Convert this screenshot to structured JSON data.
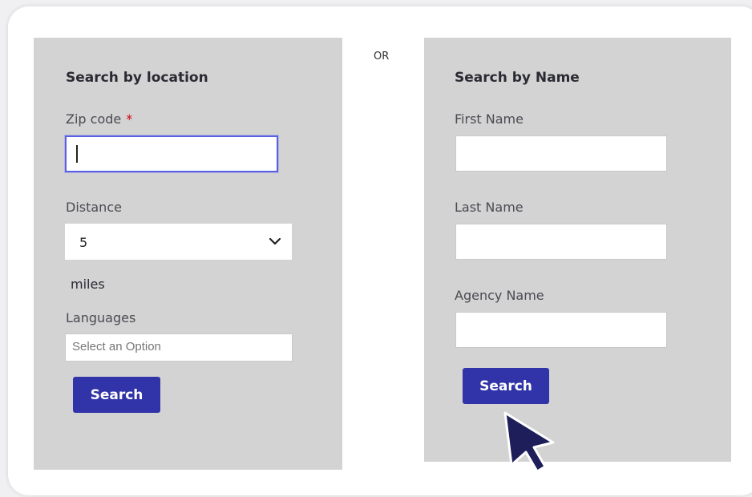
{
  "location_search": {
    "heading": "Search by location",
    "zip_label": "Zip code",
    "required_mark": "*",
    "zip_value": "",
    "distance_label": "Distance",
    "distance_value": "5",
    "distance_unit": "miles",
    "languages_label": "Languages",
    "languages_placeholder": "Select an Option",
    "search_label": "Search"
  },
  "separator": "OR",
  "name_search": {
    "heading": "Search by Name",
    "first_name_label": "First Name",
    "last_name_label": "Last Name",
    "agency_name_label": "Agency Name",
    "search_label": "Search"
  },
  "colors": {
    "panel_bg": "#d3d3d3",
    "button_bg": "#3134a8",
    "focus_border": "#5b5fe6",
    "required": "#d0021b",
    "cursor": "#1e1e5a"
  },
  "icons": {
    "dropdown": "chevron-down-icon",
    "pointer": "mouse-pointer-icon"
  }
}
